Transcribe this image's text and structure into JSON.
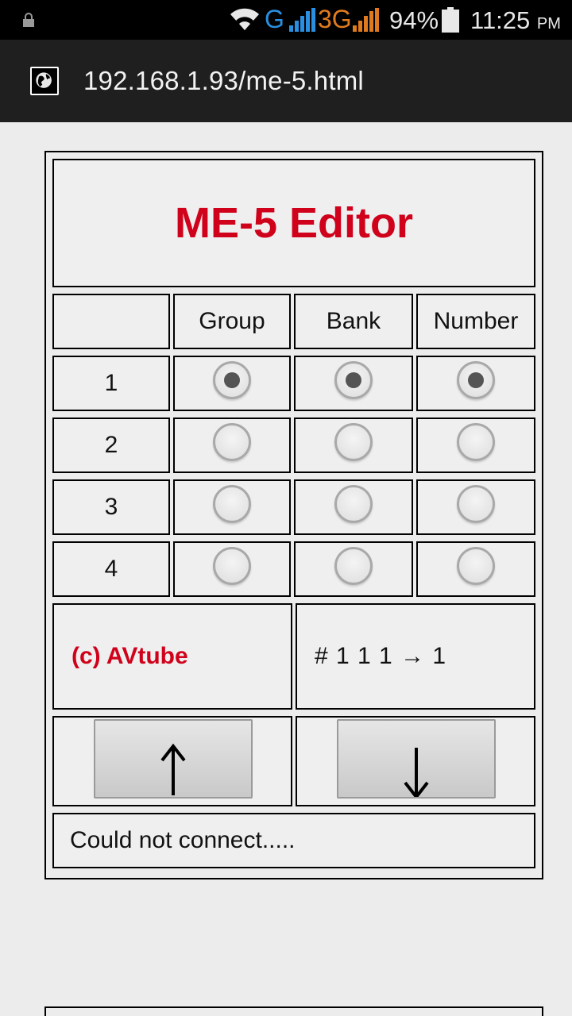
{
  "status_bar": {
    "network_g": "G",
    "network_3g": "3G",
    "battery_percent": "94%",
    "time": "11:25",
    "ampm": "PM",
    "colors": {
      "g": "#2a8fe0",
      "threeg": "#e07a1f"
    }
  },
  "browser": {
    "url": "192.168.1.93/me-5.html"
  },
  "editor": {
    "title": "ME-5 Editor",
    "title_color": "#d0021b",
    "columns": [
      "",
      "Group",
      "Bank",
      "Number"
    ],
    "rows": [
      {
        "label": "1",
        "group": true,
        "bank": true,
        "number": true
      },
      {
        "label": "2",
        "group": false,
        "bank": false,
        "number": false
      },
      {
        "label": "3",
        "group": false,
        "bank": false,
        "number": false
      },
      {
        "label": "4",
        "group": false,
        "bank": false,
        "number": false
      }
    ],
    "credit": "(c) AVtube",
    "code": "# 1 1 1 → 1",
    "up_button_icon": "arrow-up-icon",
    "down_button_icon": "arrow-down-icon",
    "status_message": "Could not connect....."
  }
}
